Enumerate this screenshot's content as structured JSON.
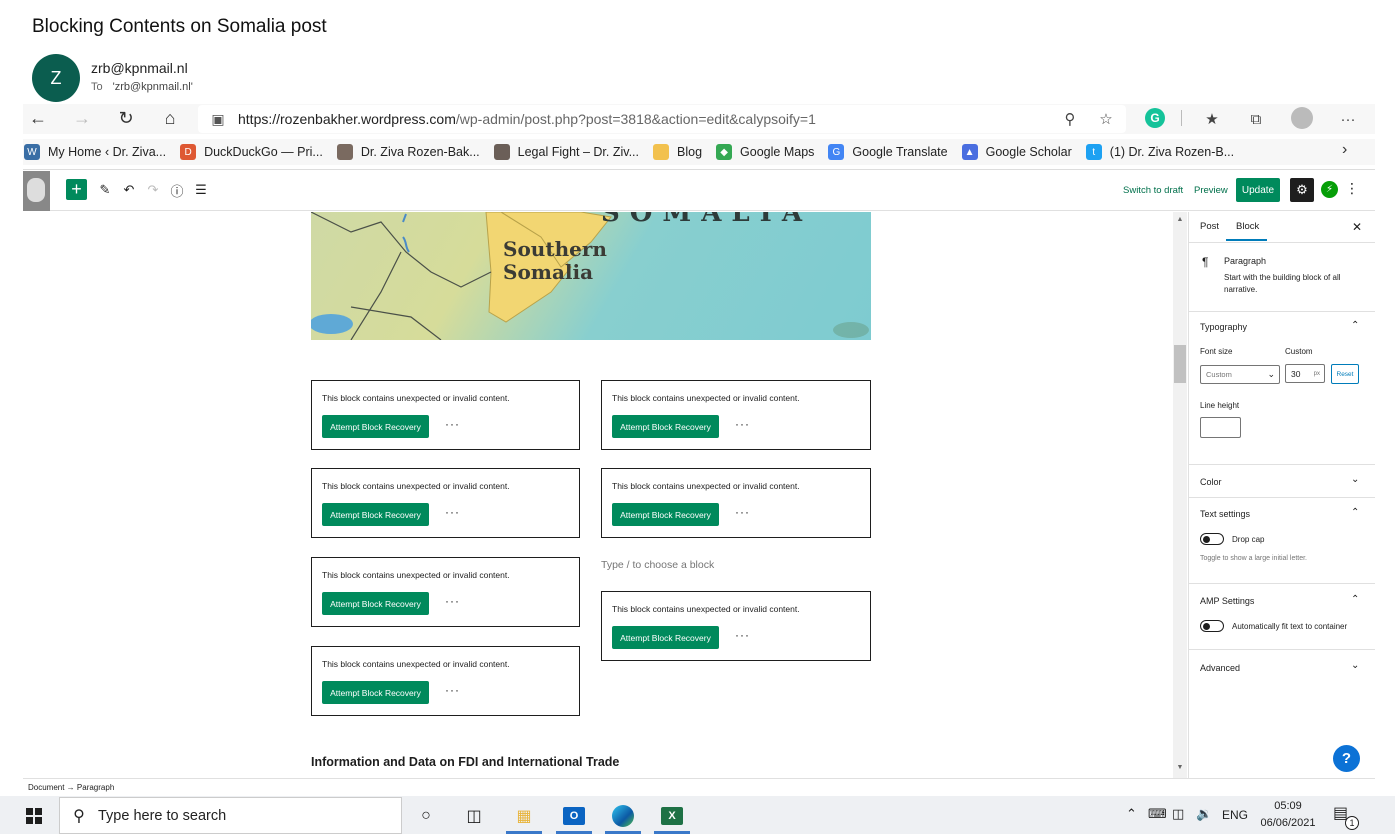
{
  "email": {
    "subject": "Blocking Contents on Somalia post",
    "avatar_initial": "Z",
    "sender": "zrb@kpnmail.nl",
    "to_label": "To",
    "recipient": "'zrb@kpnmail.nl'"
  },
  "browser": {
    "url_host": "https://rozenbakher.wordpress.com",
    "url_path": "/wp-admin/post.php?post=3818&action=edit&calypsoify=1",
    "grammarly_initial": "G",
    "bookmarks": [
      {
        "label": "My Home ‹ Dr. Ziva...",
        "color": "#3a6ea5",
        "glyph": "W"
      },
      {
        "label": "DuckDuckGo — Pri...",
        "color": "#de5833",
        "glyph": "D"
      },
      {
        "label": "Dr. Ziva Rozen-Bak...",
        "color": "#7a6a60",
        "glyph": ""
      },
      {
        "label": "Legal Fight – Dr. Ziv...",
        "color": "#6b5f58",
        "glyph": ""
      },
      {
        "label": "Blog",
        "color": "#f2c14e",
        "glyph": ""
      },
      {
        "label": "Google Maps",
        "color": "#34a853",
        "glyph": "◆"
      },
      {
        "label": "Google Translate",
        "color": "#4285f4",
        "glyph": "G"
      },
      {
        "label": "Google Scholar",
        "color": "#4a6ee0",
        "glyph": "▲"
      },
      {
        "label": "(1) Dr. Ziva Rozen-B...",
        "color": "#1da1f2",
        "glyph": "t"
      }
    ]
  },
  "wp": {
    "switch_to_draft": "Switch to draft",
    "preview": "Preview",
    "update": "Update",
    "map_title": "SOMALIA",
    "map_label_line1": "Southern",
    "map_label_line2": "Somalia",
    "invalid_message": "This block contains unexpected or invalid content.",
    "recover_label": "Attempt Block Recovery",
    "more_label": "···",
    "placeholder": "Type / to choose a block",
    "heading": "Information and Data on FDI and International Trade",
    "breadcrumb": "Document → Paragraph"
  },
  "sidebar": {
    "tab_post": "Post",
    "tab_block": "Block",
    "block_title": "Paragraph",
    "block_desc": "Start with the building block of all narrative.",
    "typography": "Typography",
    "font_size_label": "Font size",
    "custom_label": "Custom",
    "font_size_select": "Custom",
    "font_size_value": "30",
    "font_size_unit": "px",
    "reset_label": "Reset",
    "line_height_label": "Line height",
    "color": "Color",
    "text_settings": "Text settings",
    "drop_cap": "Drop cap",
    "drop_cap_help": "Toggle to show a large initial letter.",
    "amp_settings": "AMP Settings",
    "amp_toggle": "Automatically fit text to container",
    "advanced": "Advanced",
    "help": "?"
  },
  "taskbar": {
    "search_placeholder": "Type here to search",
    "language": "ENG",
    "time": "05:09",
    "date": "06/06/2021",
    "notification_count": "1"
  }
}
